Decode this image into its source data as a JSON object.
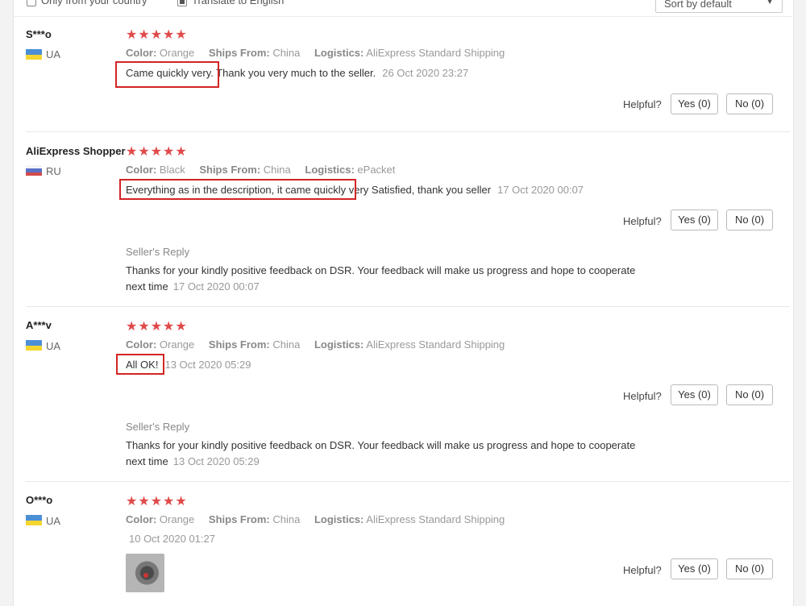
{
  "filters": {
    "only_country_label": "Only from your country",
    "translate_label": "Translate to English",
    "sort_label": "Sort by default"
  },
  "field_labels": {
    "color": "Color:",
    "ships_from": "Ships From:",
    "logistics": "Logistics:",
    "helpful": "Helpful?",
    "seller_reply": "Seller's Reply"
  },
  "reviews": [
    {
      "name": "S***o",
      "country": "UA",
      "stars": "★★★★★",
      "color": "Orange",
      "ships_from": "China",
      "logistics": "AliExpress Standard Shipping",
      "text_highlight": "Came quickly very.",
      "text_rest": " Thank you very much to the seller.",
      "date": "26 Oct 2020 23:27",
      "yes": "Yes (0)",
      "no": "No (0)"
    },
    {
      "name": "AliExpress Shopper",
      "country": "RU",
      "stars": "★★★★★",
      "color": "Black",
      "ships_from": "China",
      "logistics": "ePacket",
      "text_highlight": "Everything as in the description, it came quickly",
      "text_rest": " very Satisfied, thank you seller",
      "date": "17 Oct 2020 00:07",
      "yes": "Yes (0)",
      "no": "No (0)",
      "reply_line1": "Thanks for your kindly positive feedback on DSR. Your feedback will make us progress and hope to cooperate",
      "reply_line2": "next time",
      "reply_date": "17 Oct 2020 00:07"
    },
    {
      "name": "A***v",
      "country": "UA",
      "stars": "★★★★★",
      "color": "Orange",
      "ships_from": "China",
      "logistics": "AliExpress Standard Shipping",
      "text_highlight": "All OK!",
      "text_rest": "",
      "date": "13 Oct 2020 05:29",
      "yes": "Yes (0)",
      "no": "No (0)",
      "reply_line1": "Thanks for your kindly positive feedback on DSR. Your feedback will make us progress and hope to cooperate",
      "reply_line2": "next time",
      "reply_date": "13 Oct 2020 05:29"
    },
    {
      "name": "O***o",
      "country": "UA",
      "stars": "★★★★★",
      "color": "Orange",
      "ships_from": "China",
      "logistics": "AliExpress Standard Shipping",
      "date": "10 Oct 2020 01:27",
      "yes": "Yes (0)",
      "no": "No (0)"
    }
  ]
}
